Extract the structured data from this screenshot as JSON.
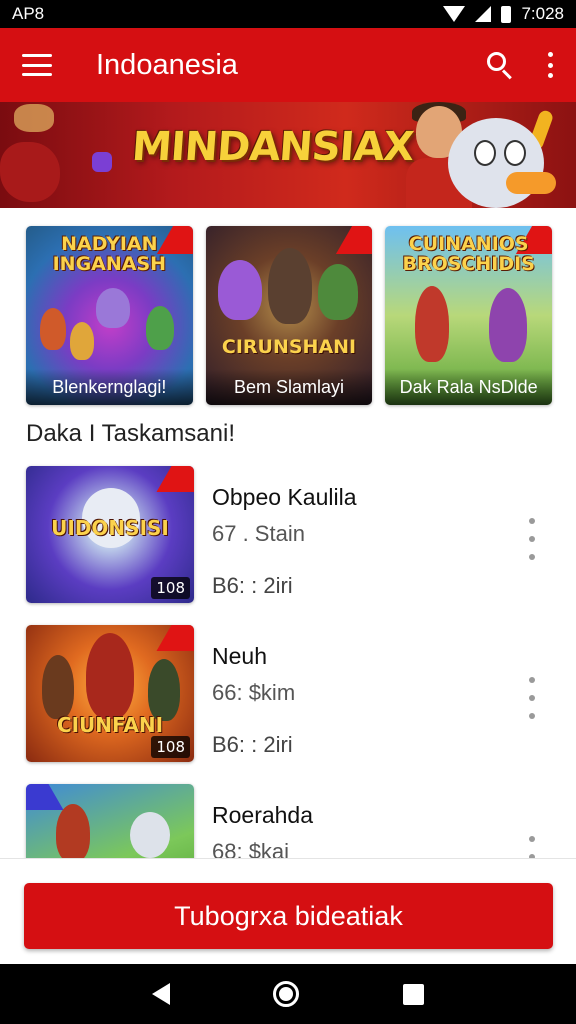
{
  "status_bar": {
    "left_text": "AP8",
    "time": "7:028"
  },
  "app_bar": {
    "title": "Indoanesia"
  },
  "banner": {
    "logo_text": "MINDANSIAX"
  },
  "featured": [
    {
      "art_title": "NADYIAN INGANASH",
      "caption": "Blenkernglagi!"
    },
    {
      "art_title": "CIRUNSHANI",
      "caption": "Bem Slamlayi"
    },
    {
      "art_title": "CUINANIOS BROSCHIDIS",
      "caption": "Dak Rala NsDlde"
    }
  ],
  "section": {
    "title": "Daka I Taskamsani!"
  },
  "list_items": [
    {
      "thumb_title": "UIDONSISI",
      "badge": "108",
      "title": "Obpeo Kaulila",
      "sub1": "67 . Stain",
      "sub2": "B6: : 2iri"
    },
    {
      "thumb_title": "CIUNFANI",
      "badge": "108",
      "title": "Neuh",
      "sub1": "66: $kim",
      "sub2": "B6: : 2iri"
    },
    {
      "thumb_title": "",
      "badge": "",
      "title": "Roerahda",
      "sub1": "68: $kai",
      "sub2": ""
    }
  ],
  "cta": {
    "label": "Tubogrxa bideatiak"
  },
  "colors": {
    "accent": "#d50f12",
    "status_bar": "#000000",
    "nav_bar": "#000000"
  },
  "icons": [
    "menu-icon",
    "search-icon",
    "overflow-menu-icon",
    "more-icon",
    "back-icon",
    "home-icon",
    "recents-icon"
  ]
}
